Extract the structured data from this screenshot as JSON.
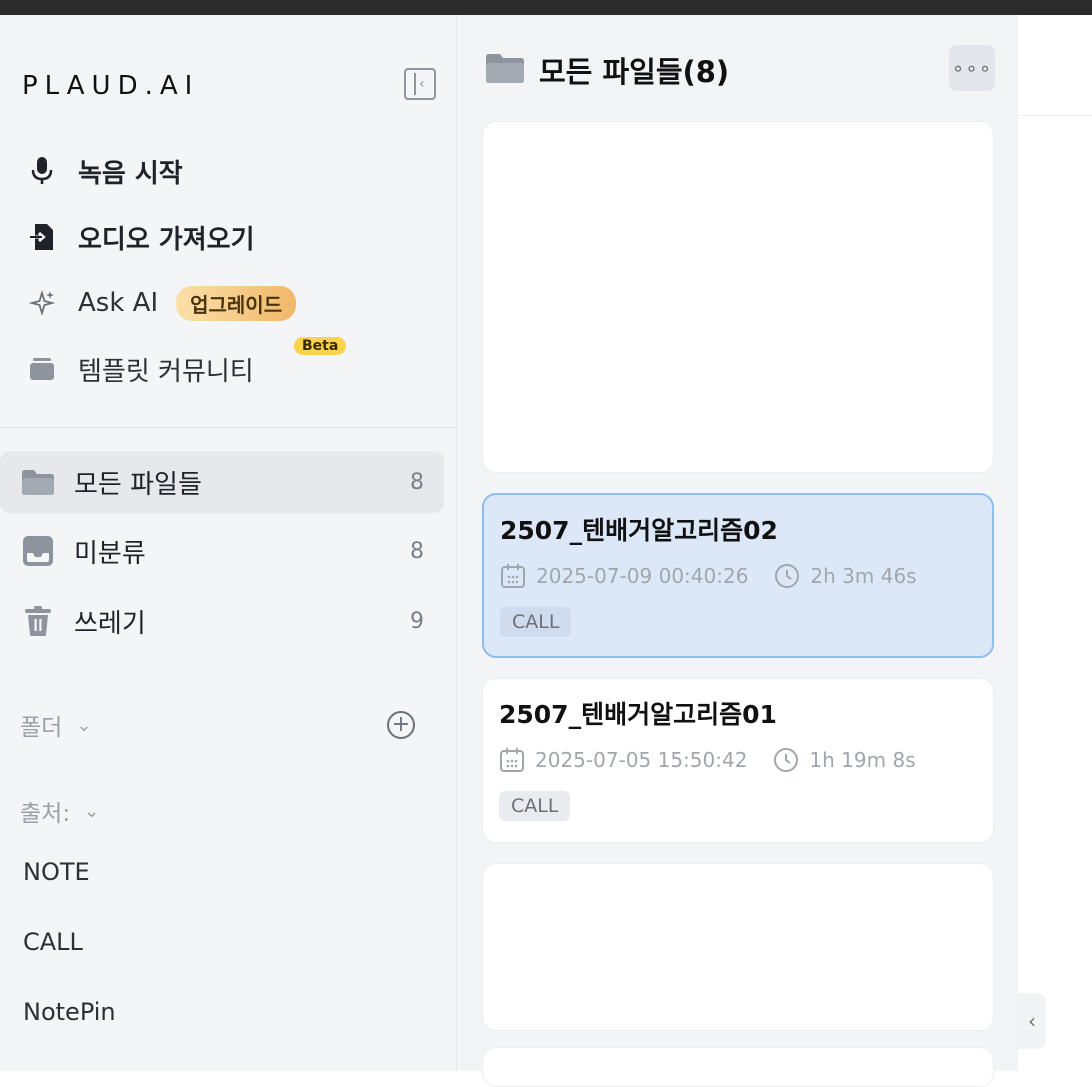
{
  "app": {
    "logo": "PLAUD.AI"
  },
  "sidebar": {
    "actions": [
      {
        "label": "녹음 시작",
        "icon": "microphone-icon"
      },
      {
        "label": "오디오 가져오기",
        "icon": "import-file-icon"
      },
      {
        "label": "Ask AI",
        "icon": "sparkle-icon",
        "badge": "업그레이드"
      },
      {
        "label": "템플릿 커뮤니티",
        "icon": "template-stack-icon",
        "badge": "Beta"
      }
    ],
    "nav": [
      {
        "label": "모든 파일들",
        "count": "8",
        "icon": "folder-icon",
        "active": true
      },
      {
        "label": "미분류",
        "count": "8",
        "icon": "inbox-icon"
      },
      {
        "label": "쓰레기",
        "count": "9",
        "icon": "trash-icon"
      }
    ],
    "folders_label": "폴더",
    "sources_label": "출처:",
    "sources": [
      "NOTE",
      "CALL",
      "NotePin"
    ]
  },
  "list": {
    "title": "모든 파일들(8)",
    "more_label": "∘∘∘",
    "cards": [
      {
        "title": "2507_텐배거알고리즘02",
        "date": "2025-07-09 00:40:26",
        "duration": "2h 3m 46s",
        "tag": "CALL",
        "selected": true
      },
      {
        "title": "2507_텐배거알고리즘01",
        "date": "2025-07-05 15:50:42",
        "duration": "1h 19m 8s",
        "tag": "CALL"
      }
    ]
  },
  "colors": {
    "accent": "#e4343a",
    "selected_bg": "#dce8f8",
    "selected_border": "#8fbdf0",
    "badge_gold": "#f0b86a",
    "beta_yellow": "#fcd34d"
  }
}
